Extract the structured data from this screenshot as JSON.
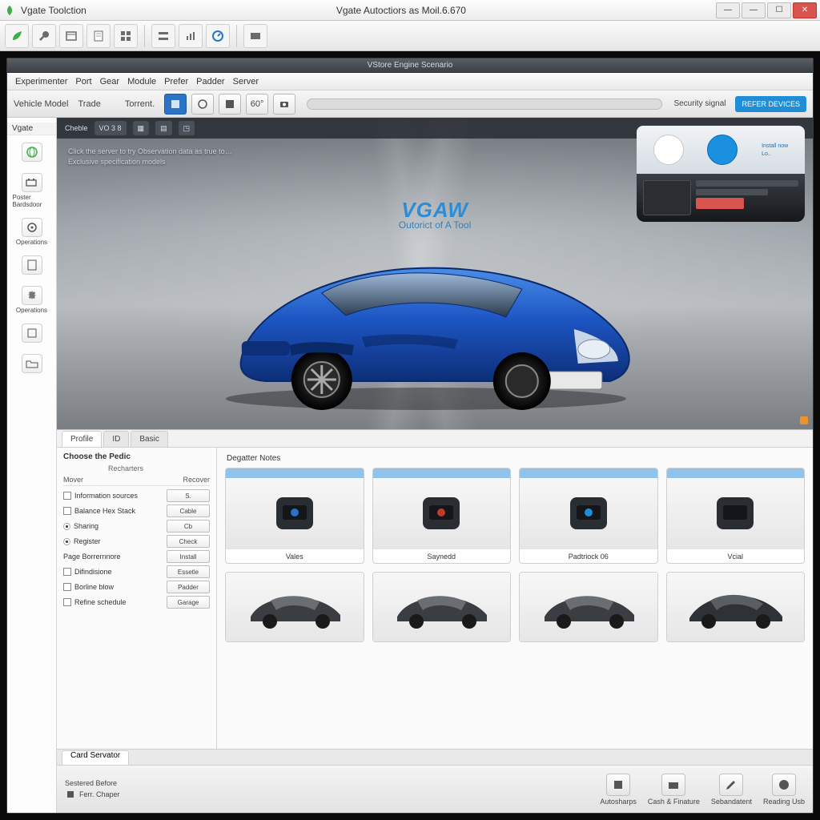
{
  "titlebar": {
    "left_title": "Vgate Toolction",
    "center_title": "Vgate Autoctiors as Moil.6.670"
  },
  "toolbar_icons": [
    "leaf",
    "wrench",
    "window",
    "page",
    "grid",
    "rows",
    "chart",
    "gauge",
    "app",
    "magnify"
  ],
  "sub_title": "VStore Engine Scenario",
  "menubar": [
    "Experimenter",
    "Port",
    "Gear",
    "Module",
    "Prefer",
    "Padder",
    "Server"
  ],
  "minitb": {
    "label_a": "Vehicle Model",
    "label_b": "Trade",
    "text_btn": "Torrent.",
    "num_btn": "60°",
    "right_link": "Security signal",
    "right_pill": "REFER DEVICES"
  },
  "leftbar": {
    "header": "Vgate",
    "items": [
      {
        "icon": "globe",
        "label": ""
      },
      {
        "icon": "battery",
        "label": "Poster Bardsdoor"
      },
      {
        "icon": "gear",
        "label": "Operations"
      },
      {
        "icon": "doc",
        "label": ""
      },
      {
        "icon": "cog",
        "label": "Operations"
      },
      {
        "icon": "cube",
        "label": ""
      },
      {
        "icon": "folder",
        "label": ""
      }
    ]
  },
  "hero": {
    "strip": [
      "Cheble",
      "VO 3 8",
      "□",
      "□",
      "□"
    ],
    "blurb_line1": "Click the server to try Observation data as true to…",
    "blurb_line2": "Exclusive specification models",
    "brand_logo": "VGAW",
    "brand_tag": "Outorict of A Tool",
    "promo": {
      "label_a": "Install now",
      "label_b": "Lo.."
    }
  },
  "tabs": [
    "Profile",
    "ID",
    "Basic"
  ],
  "options": {
    "header": "Choose the Pedic",
    "sub": "Recharters",
    "col_a": "Mover",
    "col_b": "Recover",
    "rows": [
      {
        "label": "Information sources",
        "ctrl": "S."
      },
      {
        "label": "Balance Hex Stack",
        "ctrl": "Cable"
      },
      {
        "label": "Sharing",
        "ctrl": "Cb"
      },
      {
        "label": "Register",
        "ctrl": "Check"
      },
      {
        "label": "Page Borrernnore",
        "ctrl": "Install"
      },
      {
        "label": "Difindisione",
        "ctrl": "Essetle"
      },
      {
        "label": "Borline blow",
        "ctrl": "Padder"
      },
      {
        "label": "Refine schedule",
        "ctrl": "Garage"
      }
    ]
  },
  "grid": {
    "header": "Degatter Notes",
    "devices": [
      "Vales",
      "Saynedd",
      "Padtriock 06",
      "Vcial"
    ]
  },
  "status": {
    "tab": "Card Servator",
    "line_a": "Sestered Before",
    "line_b": "Ferr. Chaper",
    "items": [
      "Autosharps",
      "Cash & Finature",
      "Sebandatent",
      "Reading Usb"
    ]
  }
}
